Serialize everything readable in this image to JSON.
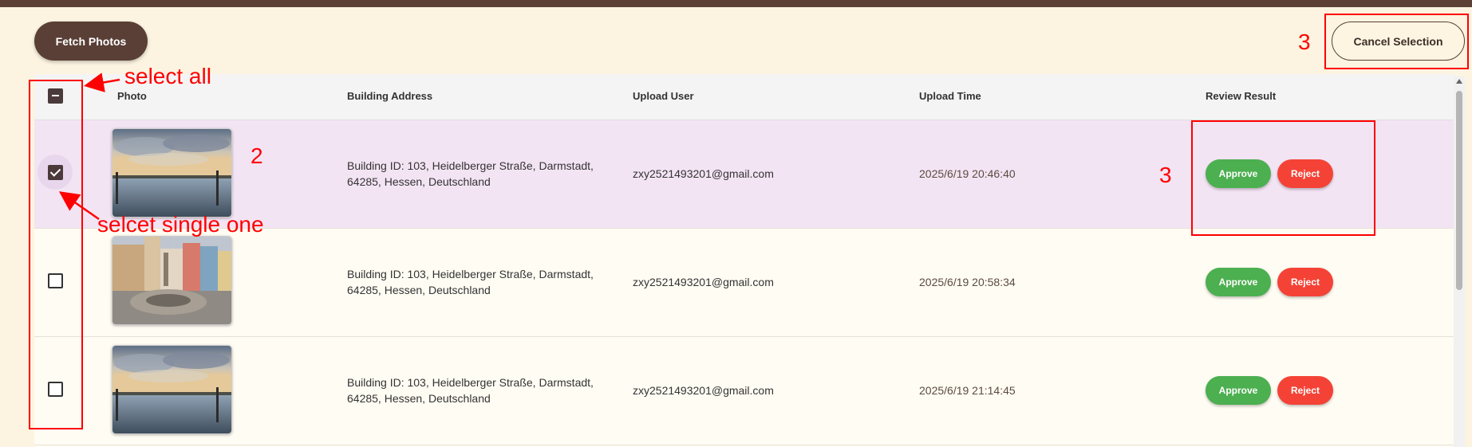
{
  "toolbar": {
    "fetch_label": "Fetch Photos",
    "cancel_label": "Cancel Selection"
  },
  "table": {
    "headers": {
      "photo": "Photo",
      "address": "Building Address",
      "user": "Upload User",
      "time": "Upload Time",
      "review": "Review Result"
    },
    "select_all_state": "indeterminate",
    "rows": [
      {
        "selected": true,
        "photo": "lakeside-harbor-photo",
        "address": "Building ID: 103, Heidelberger Straße, Darmstadt, 64285, Hessen, Deutschland",
        "user": "zxy2521493201@gmail.com",
        "time": "2025/6/19 20:46:40",
        "approve": "Approve",
        "reject": "Reject"
      },
      {
        "selected": false,
        "photo": "town-square-fountain-photo",
        "address": "Building ID: 103, Heidelberger Straße, Darmstadt, 64285, Hessen, Deutschland",
        "user": "zxy2521493201@gmail.com",
        "time": "2025/6/19 20:58:34",
        "approve": "Approve",
        "reject": "Reject"
      },
      {
        "selected": false,
        "photo": "lakeside-harbor-photo",
        "address": "Building ID: 103, Heidelberger Straße, Darmstadt, 64285, Hessen, Deutschland",
        "user": "zxy2521493201@gmail.com",
        "time": "2025/6/19 21:14:45",
        "approve": "Approve",
        "reject": "Reject"
      }
    ]
  },
  "annotations": {
    "select_all": "select all",
    "select_single": "selcet single one",
    "num_2": "2",
    "num_3_cancel": "3",
    "num_3_review": "3"
  },
  "colors": {
    "background": "#fcf4e0",
    "brand_brown": "#5a3f36",
    "selected_row": "#f3e4f4",
    "approve": "#4caf50",
    "reject": "#f44336",
    "annotation": "#ff0000"
  }
}
